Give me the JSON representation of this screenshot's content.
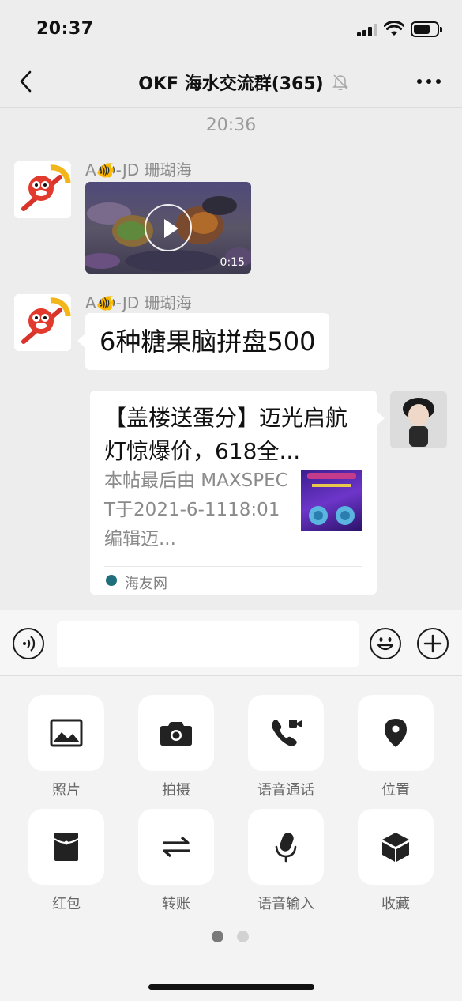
{
  "status_bar": {
    "time": "20:37"
  },
  "nav": {
    "title": "OKF 海水交流群(365)"
  },
  "chat": {
    "timestamp": "20:36",
    "messages": [
      {
        "sender": "A🐠-JD 珊瑚海",
        "type": "video",
        "duration": "0:15"
      },
      {
        "sender": "A🐠-JD 珊瑚海",
        "type": "text",
        "text": "6种糖果脑拼盘500"
      },
      {
        "type": "link",
        "title": "【盖楼送蛋分】迈光启航灯惊爆价，618全...",
        "description": "本帖最后由 MAXSPECT于2021-6-1118:01编辑迈...",
        "source": "海友网"
      }
    ]
  },
  "input": {
    "placeholder": ""
  },
  "panel": {
    "tools": [
      {
        "label": "照片",
        "icon": "image-icon"
      },
      {
        "label": "拍摄",
        "icon": "camera-icon"
      },
      {
        "label": "语音通话",
        "icon": "phone-video-icon"
      },
      {
        "label": "位置",
        "icon": "location-pin-icon"
      },
      {
        "label": "红包",
        "icon": "red-packet-icon"
      },
      {
        "label": "转账",
        "icon": "transfer-icon"
      },
      {
        "label": "语音输入",
        "icon": "microphone-icon"
      },
      {
        "label": "收藏",
        "icon": "favorites-box-icon"
      }
    ],
    "page_dots": {
      "count": 2,
      "active": 0
    }
  },
  "colors": {
    "background": "#ededed",
    "panel": "#f3f3f3",
    "bubble": "#ffffff",
    "secondary_text": "#8c8c8c"
  }
}
